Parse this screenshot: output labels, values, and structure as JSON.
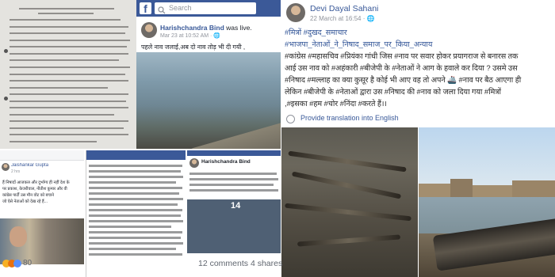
{
  "panel2": {
    "search_placeholder": "Search",
    "author": "Harishchandra Bind",
    "action": " was live.",
    "meta": "Mar 23 at 10:52 AM · ",
    "text": "पहले नाव जलाई,अब दो नाव तोड़ भी दी गयी ,"
  },
  "panel3": {
    "author": "Devi Dayal Sahani",
    "meta": "22 March at 16:54 · ",
    "lines": [
      "#मित्रों #दुखद_समाचार",
      "#भाजपा_नेताओं_ने_निषाद_समाज_पर_किया_अन्याय",
      "#कांग्रेस #महासचिव #प्रियंका गांधी जिस #नाव पर सवार होकर प्रयागराज से बनारस तक",
      "आई उस नाव को #अहंकारी #बीजेपी के #नेताओं ने आग के हवाले कर दिया ? उसमे उस",
      "#निषाद #मल्लाह का क्या कुसूर है कोई भी आए वह तो अपने 🚢 #नाव पर बैठ आएगा ही",
      "लेकिन #बीजेपी के #नेताओं द्वारा उस #निषाद की #नाव को जला दिया गया #मित्रों",
      ",#इसका #हम #चोर #निंदा #करते हैं।।"
    ],
    "translate": "Provide translation into English"
  },
  "panel5": {
    "author": "Jaishankar Gupta",
    "date": "2 hrs",
    "lines": [
      "हैं निषादों आजकल और दुर्भाग्य ही नहीं देश के",
      "पर प्रकाश, केजरीवाल, नीतीश कुमार और वी",
      "कांग्रेस पार्टी उस मौन वोट को बचाने",
      "जो ऐसे नेताओं को देख रहे हैं..."
    ],
    "reactions": "80"
  },
  "panel7": {
    "author": "Harishchandra Bind",
    "overlay": "14"
  },
  "footer": {
    "comments": "12 comments  4 shares"
  },
  "colors": {
    "fb_blue": "#3b5998",
    "link": "#385898",
    "hashtag": "#365899"
  }
}
